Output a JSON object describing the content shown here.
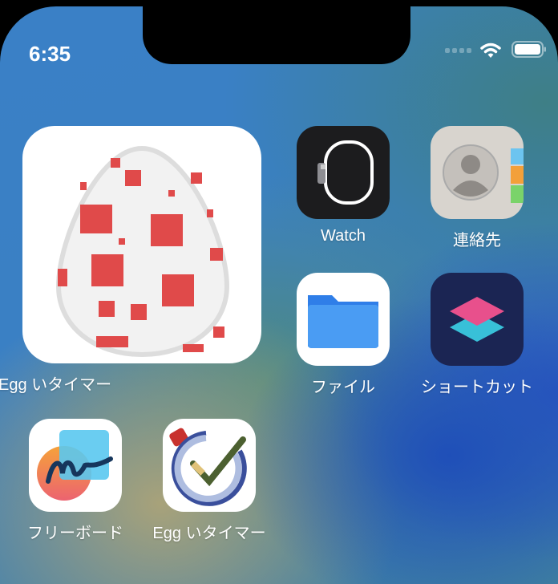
{
  "status_bar": {
    "time": "6:35"
  },
  "apps": [
    {
      "id": "egg-widget",
      "label": "Egg いタイマー"
    },
    {
      "id": "watch",
      "label": "Watch"
    },
    {
      "id": "contacts",
      "label": "連絡先"
    },
    {
      "id": "files",
      "label": "ファイル"
    },
    {
      "id": "shortcuts",
      "label": "ショートカット"
    },
    {
      "id": "freeform",
      "label": "フリーボード"
    },
    {
      "id": "egg-timer",
      "label": "Egg いタイマー"
    }
  ]
}
